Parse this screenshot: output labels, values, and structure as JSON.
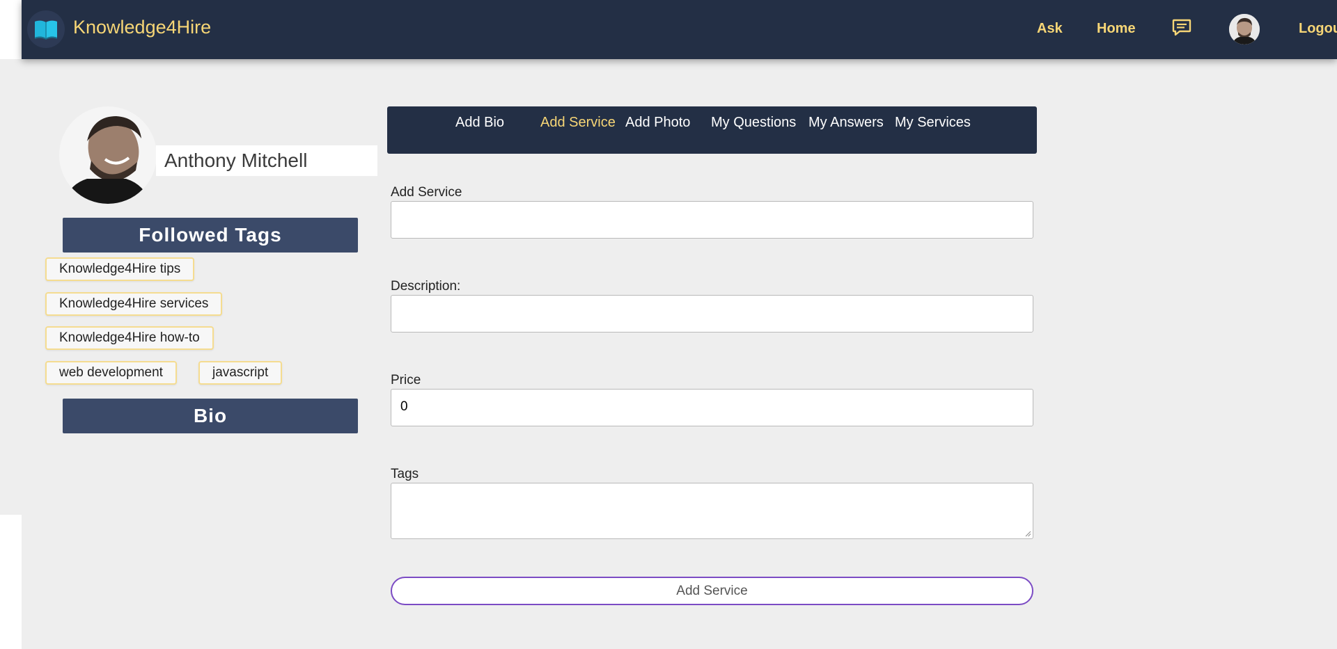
{
  "navbar": {
    "brand_name": "Knowledge4Hire",
    "logo_icon": "open-book-icon",
    "links": {
      "ask": "Ask",
      "home": "Home",
      "logout": "Logout"
    },
    "chat_icon": "chat-bubble-icon"
  },
  "profile": {
    "name": "Anthony Mitchell",
    "followed_tags_title": "Followed Tags",
    "tags": [
      "Knowledge4Hire tips",
      "Knowledge4Hire services",
      "Knowledge4Hire how-to",
      "web development",
      "javascript"
    ],
    "bio_title": "Bio"
  },
  "tabs": [
    {
      "label": "Add Bio",
      "active": false
    },
    {
      "label": "Add Service",
      "active": true
    },
    {
      "label": "Add Photo",
      "active": false
    },
    {
      "label": "My Questions",
      "active": false
    },
    {
      "label": "My Answers",
      "active": false
    },
    {
      "label": "My Services",
      "active": false
    }
  ],
  "form": {
    "service_label": "Add Service",
    "service_value": "",
    "description_label": "Description:",
    "description_value": "",
    "price_label": "Price",
    "price_value": "0",
    "tags_label": "Tags",
    "tags_value": "",
    "submit_label": "Add Service"
  },
  "colors": {
    "navbar_bg": "#232f45",
    "accent_yellow": "#f7d676",
    "section_header_bg": "#3b4a69",
    "tag_border": "#f5dc90",
    "submit_border": "#7b4bc4",
    "page_bg": "#eeeeee"
  }
}
